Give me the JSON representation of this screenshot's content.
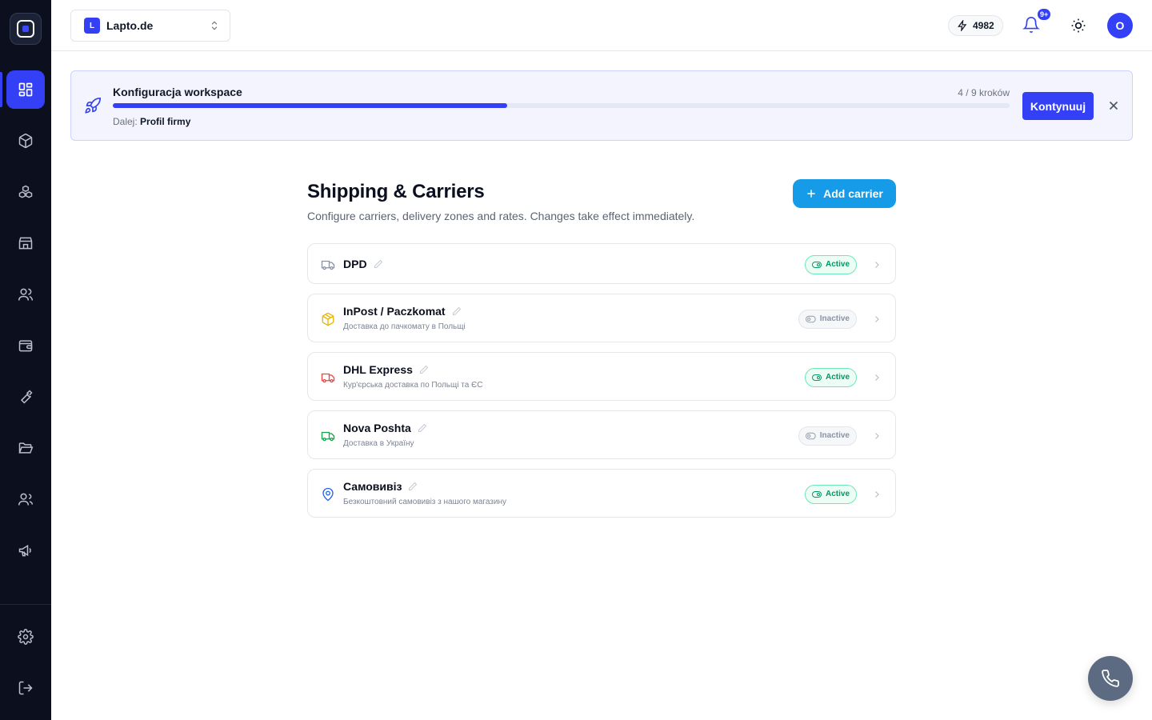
{
  "sidebar": {
    "items": [
      {
        "icon": "dashboard-icon",
        "active": true
      },
      {
        "icon": "package-icon",
        "active": false
      },
      {
        "icon": "boxes-icon",
        "active": false
      },
      {
        "icon": "store-icon",
        "active": false
      },
      {
        "icon": "users-icon",
        "active": false
      },
      {
        "icon": "wallet-icon",
        "active": false
      },
      {
        "icon": "wrench-icon",
        "active": false
      },
      {
        "icon": "folder-open-icon",
        "active": false
      },
      {
        "icon": "team-icon",
        "active": false
      },
      {
        "icon": "megaphone-icon",
        "active": false
      },
      {
        "icon": "settings-icon",
        "active": false
      },
      {
        "icon": "logout-icon",
        "active": false
      }
    ]
  },
  "header": {
    "workspace_badge": "L",
    "workspace_name": "Lapto.de",
    "credits": "4982",
    "notifications_badge": "9+",
    "avatar_initial": "O"
  },
  "onboarding": {
    "title": "Konfiguracja workspace",
    "steps_text": "4 / 9 kroków",
    "progress": 0.44,
    "next_label": "Dalej:",
    "next_value": "Profil firmy",
    "continue_label": "Kontynuuj"
  },
  "page": {
    "title": "Shipping & Carriers",
    "subtitle": "Configure carriers, delivery zones and rates. Changes take effect immediately.",
    "add_button_label": "Add carrier"
  },
  "carriers": [
    {
      "name": "DPD",
      "description": "",
      "status": "Active",
      "icon": "truck-icon",
      "icon_color": "#8a93a3"
    },
    {
      "name": "InPost / Paczkomat",
      "description": "Доставка до пачкомату в Польщі",
      "status": "Inactive",
      "icon": "package-icon",
      "icon_color": "#eab308"
    },
    {
      "name": "DHL Express",
      "description": "Кур'єрська доставка по Польщі та ЄС",
      "status": "Active",
      "icon": "truck-icon",
      "icon_color": "#ef4444"
    },
    {
      "name": "Nova Poshta",
      "description": "Доставка в Україну",
      "status": "Inactive",
      "icon": "truck-icon",
      "icon_color": "#16a34a"
    },
    {
      "name": "Самовивіз",
      "description": "Безкоштовний самовивіз з нашого магазину",
      "status": "Active",
      "icon": "map-pin-icon",
      "icon_color": "#2563eb"
    }
  ],
  "colors": {
    "brand": "#3440f5",
    "add_button": "#159be8",
    "sidebar_bg": "#0b0f1e",
    "active_green": "#059669"
  }
}
